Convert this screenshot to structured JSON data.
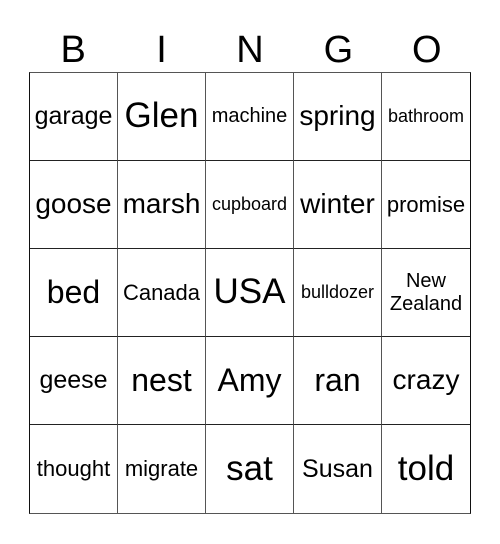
{
  "header": {
    "letters": [
      "B",
      "I",
      "N",
      "G",
      "O"
    ]
  },
  "board": {
    "rows": [
      [
        "garage",
        "Glen",
        "machine",
        "spring",
        "bathroom"
      ],
      [
        "goose",
        "marsh",
        "cupboard",
        "winter",
        "promise"
      ],
      [
        "bed",
        "Canada",
        "USA",
        "bulldozer",
        "New Zealand"
      ],
      [
        "geese",
        "nest",
        "Amy",
        "ran",
        "crazy"
      ],
      [
        "thought",
        "migrate",
        "sat",
        "Susan",
        "told"
      ]
    ]
  }
}
